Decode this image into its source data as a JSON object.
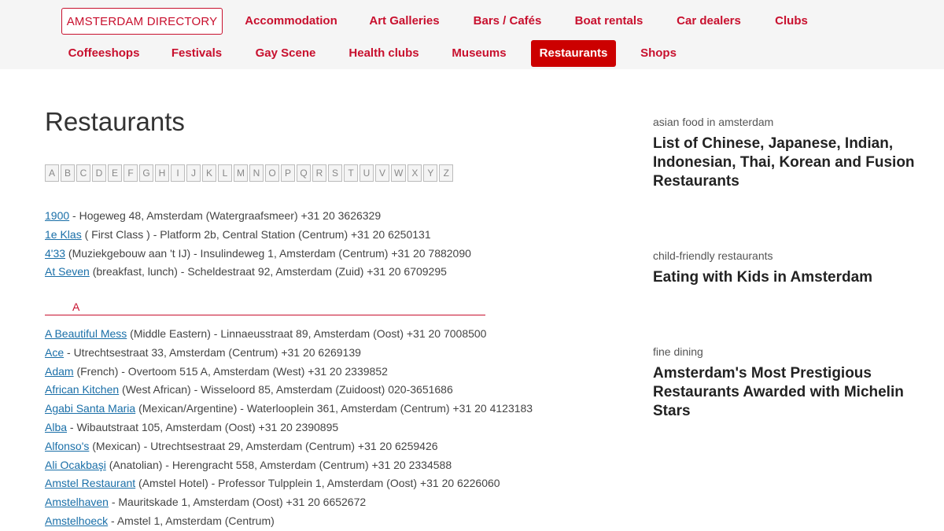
{
  "nav": {
    "brand": "AMSTERDAM DIRECTORY",
    "row1": [
      "Accommodation",
      "Art Galleries",
      "Bars / Cafés",
      "Boat rentals",
      "Car dealers",
      "Clubs"
    ],
    "row2": [
      "Coffeeshops",
      "Festivals",
      "Gay Scene",
      "Health clubs",
      "Museums",
      "Restaurants",
      "Shops"
    ],
    "active": "Restaurants"
  },
  "colors": {
    "accent": "#c8102e",
    "active_bg": "#cc0000",
    "link": "#1a6fa8"
  },
  "page_title": "Restaurants",
  "alphabet": [
    "A",
    "B",
    "C",
    "D",
    "E",
    "F",
    "G",
    "H",
    "I",
    "J",
    "K",
    "L",
    "M",
    "N",
    "O",
    "P",
    "Q",
    "R",
    "S",
    "T",
    "U",
    "V",
    "W",
    "X",
    "Y",
    "Z"
  ],
  "numeric_entries": [
    {
      "name": "1900",
      "details": " - Hogeweg 48, Amsterdam (Watergraafsmeer) +31 20 3626329"
    },
    {
      "name": "1e Klas",
      "details": " ( First Class ) - Platform 2b, Central Station (Centrum) +31 20 6250131"
    },
    {
      "name": "4'33",
      "details": " (Muziekgebouw aan 't IJ) - Insulindeweg 1, Amsterdam (Centrum) +31 20 7882090"
    },
    {
      "name": "At Seven",
      "details": " (breakfast, lunch) - Scheldestraat 92, Amsterdam (Zuid) +31 20 6709295"
    }
  ],
  "section_letter": "A",
  "a_entries": [
    {
      "name": "A Beautiful Mess",
      "details": " (Middle Eastern) - Linnaeusstraat 89, Amsterdam (Oost) +31 20 7008500"
    },
    {
      "name": "Ace",
      "details": " - Utrechtsestraat 33, Amsterdam (Centrum) +31 20 6269139"
    },
    {
      "name": "Adam",
      "details": " (French) - Overtoom 515 A, Amsterdam (West) +31 20 2339852"
    },
    {
      "name": "African Kitchen",
      "details": " (West African) - Wisseloord 85, Amsterdam (Zuidoost) 020-3651686"
    },
    {
      "name": "Agabi Santa Maria",
      "details": " (Mexican/Argentine) - Waterlooplein 361, Amsterdam (Centrum) +31 20 4123183"
    },
    {
      "name": "Alba",
      "details": " - Wibautstraat 105, Amsterdam (Oost) +31 20 2390895"
    },
    {
      "name": "Alfonso's",
      "details": " (Mexican) - Utrechtsestraat 29, Amsterdam (Centrum) +31 20 6259426"
    },
    {
      "name": "Ali Ocakbaşi",
      "details": " (Anatolian) - Herengracht 558, Amsterdam (Centrum) +31 20 2334588"
    },
    {
      "name": "Amstel Restaurant",
      "details": " (Amstel Hotel) - Professor Tulpplein 1, Amsterdam (Oost) +31 20 6226060"
    },
    {
      "name": "Amstelhaven",
      "details": " - Mauritskade 1, Amsterdam (Oost) +31 20 6652672"
    },
    {
      "name": "Amstelhoeck",
      "details": " - Amstel 1, Amsterdam (Centrum)"
    }
  ],
  "sidebar": [
    {
      "category": "asian food in amsterdam",
      "title": "List of Chinese, Japanese, Indian, Indonesian, Thai, Korean and Fusion Restaurants"
    },
    {
      "category": "child-friendly restaurants",
      "title": "Eating with Kids in Amsterdam"
    },
    {
      "category": "fine dining",
      "title": "Amsterdam's Most Prestigious Restaurants Awarded with Michelin Stars"
    }
  ]
}
